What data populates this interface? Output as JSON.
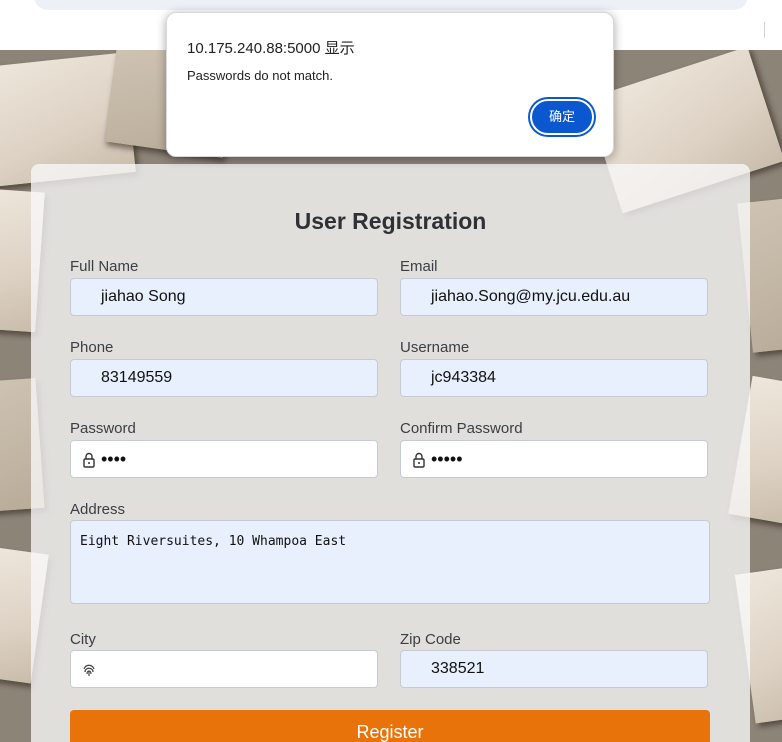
{
  "dialog": {
    "title": "10.175.240.88:5000 显示",
    "message": "Passwords do not match.",
    "ok_label": "确定"
  },
  "form": {
    "title": "User Registration",
    "full_name": {
      "label": "Full Name",
      "value": "jiahao Song"
    },
    "email": {
      "label": "Email",
      "value": "jiahao.Song@my.jcu.edu.au"
    },
    "phone": {
      "label": "Phone",
      "value": "83149559"
    },
    "username": {
      "label": "Username",
      "value": "jc943384"
    },
    "password": {
      "label": "Password",
      "value": "••••"
    },
    "confirm_password": {
      "label": "Confirm Password",
      "value": "•••••"
    },
    "address": {
      "label": "Address",
      "value": "Eight Riversuites, 10 Whampoa East"
    },
    "city": {
      "label": "City",
      "value": ""
    },
    "zip_code": {
      "label": "Zip Code",
      "value": "338521"
    },
    "register_label": "Register"
  },
  "icons": {
    "password_field_icon": "lock-icon",
    "city_field_icon": "fingerprint-icon"
  },
  "colors": {
    "register_button": "#e8730a",
    "dialog_button": "#0b57d0",
    "autofill_field": "#e8effd"
  }
}
